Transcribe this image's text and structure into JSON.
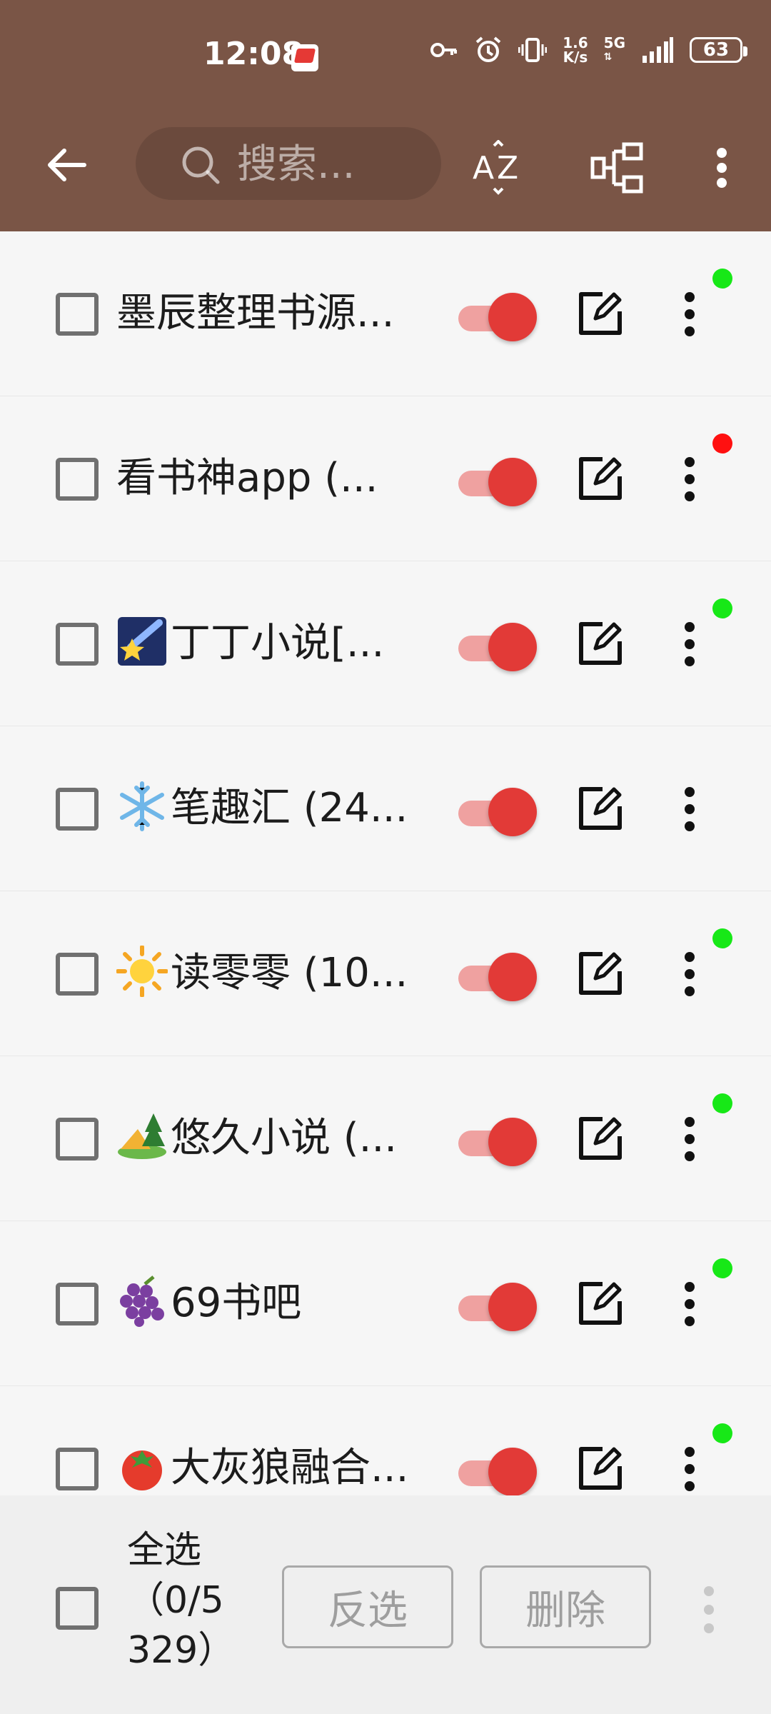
{
  "status_bar": {
    "time": "12:08",
    "net_speed_value": "1.6",
    "net_speed_unit": "K/s",
    "network": "5G",
    "battery": "63"
  },
  "toolbar": {
    "search_placeholder": "搜索..."
  },
  "items": [
    {
      "name": "墨辰整理书源...",
      "icon": "",
      "status": "green"
    },
    {
      "name": "看书神app (...",
      "icon": "",
      "status": "red"
    },
    {
      "name": "丁丁小说[...",
      "icon": "shooting-star",
      "status": "green"
    },
    {
      "name": "笔趣汇 (24...",
      "icon": "snowflake",
      "status": "none"
    },
    {
      "name": "读零零 (10...",
      "icon": "sun",
      "status": "green"
    },
    {
      "name": "悠久小说 (...",
      "icon": "camping",
      "status": "green"
    },
    {
      "name": "69书吧",
      "icon": "grapes",
      "status": "green"
    },
    {
      "name": "大灰狼融合...",
      "icon": "tomato",
      "status": "green"
    }
  ],
  "bottom_bar": {
    "select_all_line1": "全选",
    "select_all_line2": "（0/5",
    "select_all_line3": "329）",
    "invert_label": "反选",
    "delete_label": "删除"
  },
  "colors": {
    "app_bar": "#7A5546",
    "switch_on": "#E23A37",
    "status_green": "#17E817",
    "status_red": "#FF1010"
  }
}
